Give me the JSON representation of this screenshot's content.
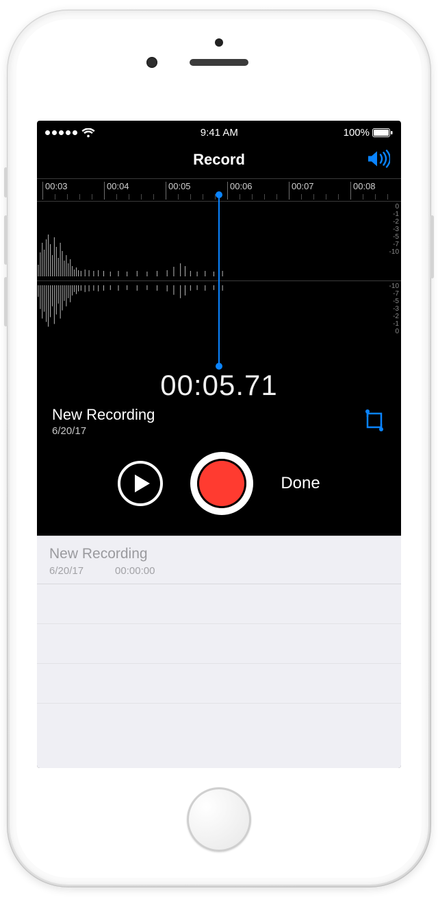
{
  "status": {
    "time": "9:41 AM",
    "battery_text": "100%"
  },
  "nav": {
    "title": "Record"
  },
  "ruler": {
    "labels": [
      "00:03",
      "00:04",
      "00:05",
      "00:06",
      "00:07",
      "00:08"
    ]
  },
  "db_scale": [
    "0",
    "-1",
    "-2",
    "-3",
    "-5",
    "-7",
    "-10"
  ],
  "db_scale_bottom": [
    "-10",
    "-7",
    "-5",
    "-3",
    "-2",
    "-1",
    "0"
  ],
  "timer": "00:05.71",
  "recording": {
    "title": "New Recording",
    "date": "6/20/17"
  },
  "controls": {
    "done_label": "Done"
  },
  "list_item": {
    "title": "New Recording",
    "date": "6/20/17",
    "duration": "00:00:00"
  },
  "colors": {
    "accent": "#0a84ff",
    "record": "#ff3b30"
  }
}
